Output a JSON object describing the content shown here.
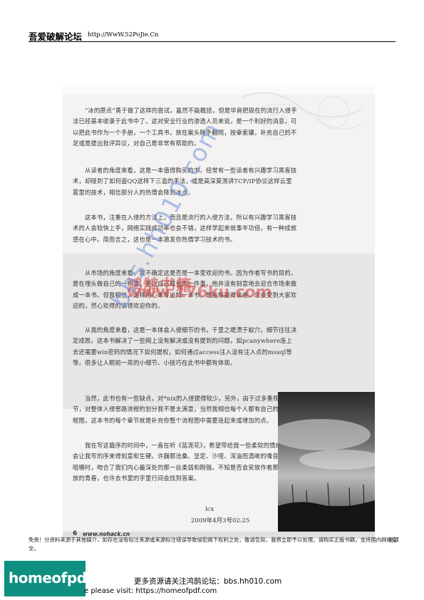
{
  "header": {
    "site_name": "吾爱破解论坛",
    "url": "http://WwW.52PoJie.Cn"
  },
  "page": {
    "paragraphs": [
      "“冰的原点”勇于做了这样的尝试，虽然不能概括，但是毕竟把现在的流行入侵手法已经基本收录于此书中了。这对安全行业的渗透人员来说，是一个利好的消息，可以把此书作为一个手册，一个工具书，放在案头随手翻阅，按章索骥，补充自己的不足或是提出批评异议，对自己是非常有帮助的。",
      "从读者的角度来看，这是一本值得购买的书。经常有一些读者有兴趣学习黑客技术，却碰到了如何盗QQ这样下三滥的手法，或是高深莫测讲TCP/IP协议这样云里雾里的技术，相信部分人的热情会降到冰点。",
      "这本书，注重在入侵的方法上，而且是流行的入侵方法，所以有兴趣学习黑客技术的人会较快上手，网络实践成功率也会不错，这样学起来就事半功倍，有一种成就感在心中。简而言之，这也是一本激发你热情学习技术的书。",
      "从市场的角度来看，我不确定这是否是一本受欢迎的书。因为作者写书的目的，是在埋头做自己的一件事，是让自己成长的一件事，他并没有刻意地去迎合市场来做成一本书。但我相信，这样用心来写出的一本书，是能够赢得读者，总会受到大家欢迎的，然心欢得的读得欢迎你的。",
      "从我的角度来看，这是一本体会入侵细节的书，千里之堤溃于蚁穴，细节往往决定成败。这本书解决了一些网上没有解决或没有提到的问题，如pcanywhere连上去还需要win密码的情况下如何提权，如何通过access注入没有注入点的mssql等等。很多让人眼前一亮的小细节、小技巧在此书中都有体现。",
      "当然，此书也有一些缺点，对*nix的入侵提得较少。另外，由于过多重视了细节，对整体入侵思路流程的划分我不是太满意，当然我相信每个人都有自己的入侵流程图，这本书的每个章节就是补充你整个流程图中需要连起来或增加的点。",
      "我在写这篇序的时间中，一直在听《蓝莲花》，希望带给我一些柔软的情绪，不会让我写的序来得刻意和生硬。许巍那沧桑、坚定、沙哑、浑油而清晰的嗓音很情地咀嚼时，吻合了我们内心最深处的那一丝柔弱和刚强。不知是否会安放作者那无处安放的青春，也许去书里的字里行间会找到答案。"
    ],
    "signature_name": "lcx",
    "signature_date": "2009年4月3号02:25",
    "page_number": "6",
    "footer_site": "www.nohack.cn"
  },
  "watermarks": {
    "diagonal": "bbs.hh010.com",
    "chinese_books": "鸿鹄书籍",
    "url": "www.176ku.com"
  },
  "disclaimer": {
    "text": "免责！分资料来源于其他媒介，如存在没有标注来源或来源标注错误导致侵犯阁下权利之处，敬请告知，我将立即予以处理。请购买正版书籍，支持国内网络安全。",
    "tail": "站部"
  },
  "logo": {
    "text": "homeofpdf.com"
  },
  "bottom": {
    "line1": "更多资源请关注鸿鹄论坛：bbs.hh010.com",
    "line2": "e please visit: https://homeofpdf.com"
  },
  "colors": {
    "logo_bg": "#0f8f7f",
    "watermark_blue": "#6e8cdc",
    "watermark_red": "#d23c3c"
  }
}
